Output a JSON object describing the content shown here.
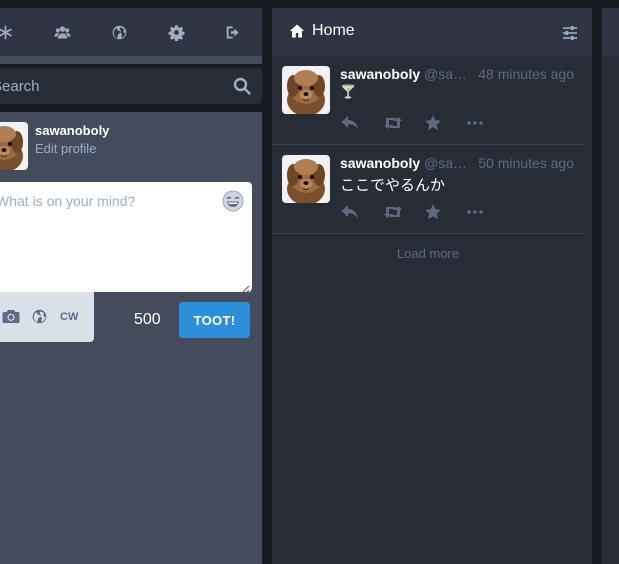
{
  "left_nav": {
    "icons": [
      "asterisk-icon",
      "users-icon",
      "globe-icon",
      "gear-icon",
      "sign-out-icon"
    ]
  },
  "search": {
    "placeholder": "Search"
  },
  "profile": {
    "username": "sawanoboly",
    "edit_label": "Edit profile"
  },
  "compose": {
    "placeholder": "What is on your mind?",
    "cw_label": "CW",
    "char_count": "500",
    "toot_label": "TOOT!"
  },
  "home": {
    "title": "Home",
    "statuses": [
      {
        "display_name": "sawanoboly",
        "handle": "@sawanoboly",
        "time": "48 minutes ago",
        "content": "🍸"
      },
      {
        "display_name": "sawanoboly",
        "handle": "@sawanoboly",
        "time": "50 minutes ago",
        "content": "ここでやるんか"
      }
    ],
    "load_more": "Load more"
  },
  "colors": {
    "accent": "#2b90d9",
    "column_bg": "#282c37",
    "header_bg": "#313543",
    "muted_text": "#606984",
    "secondary_text": "#9baec8"
  }
}
